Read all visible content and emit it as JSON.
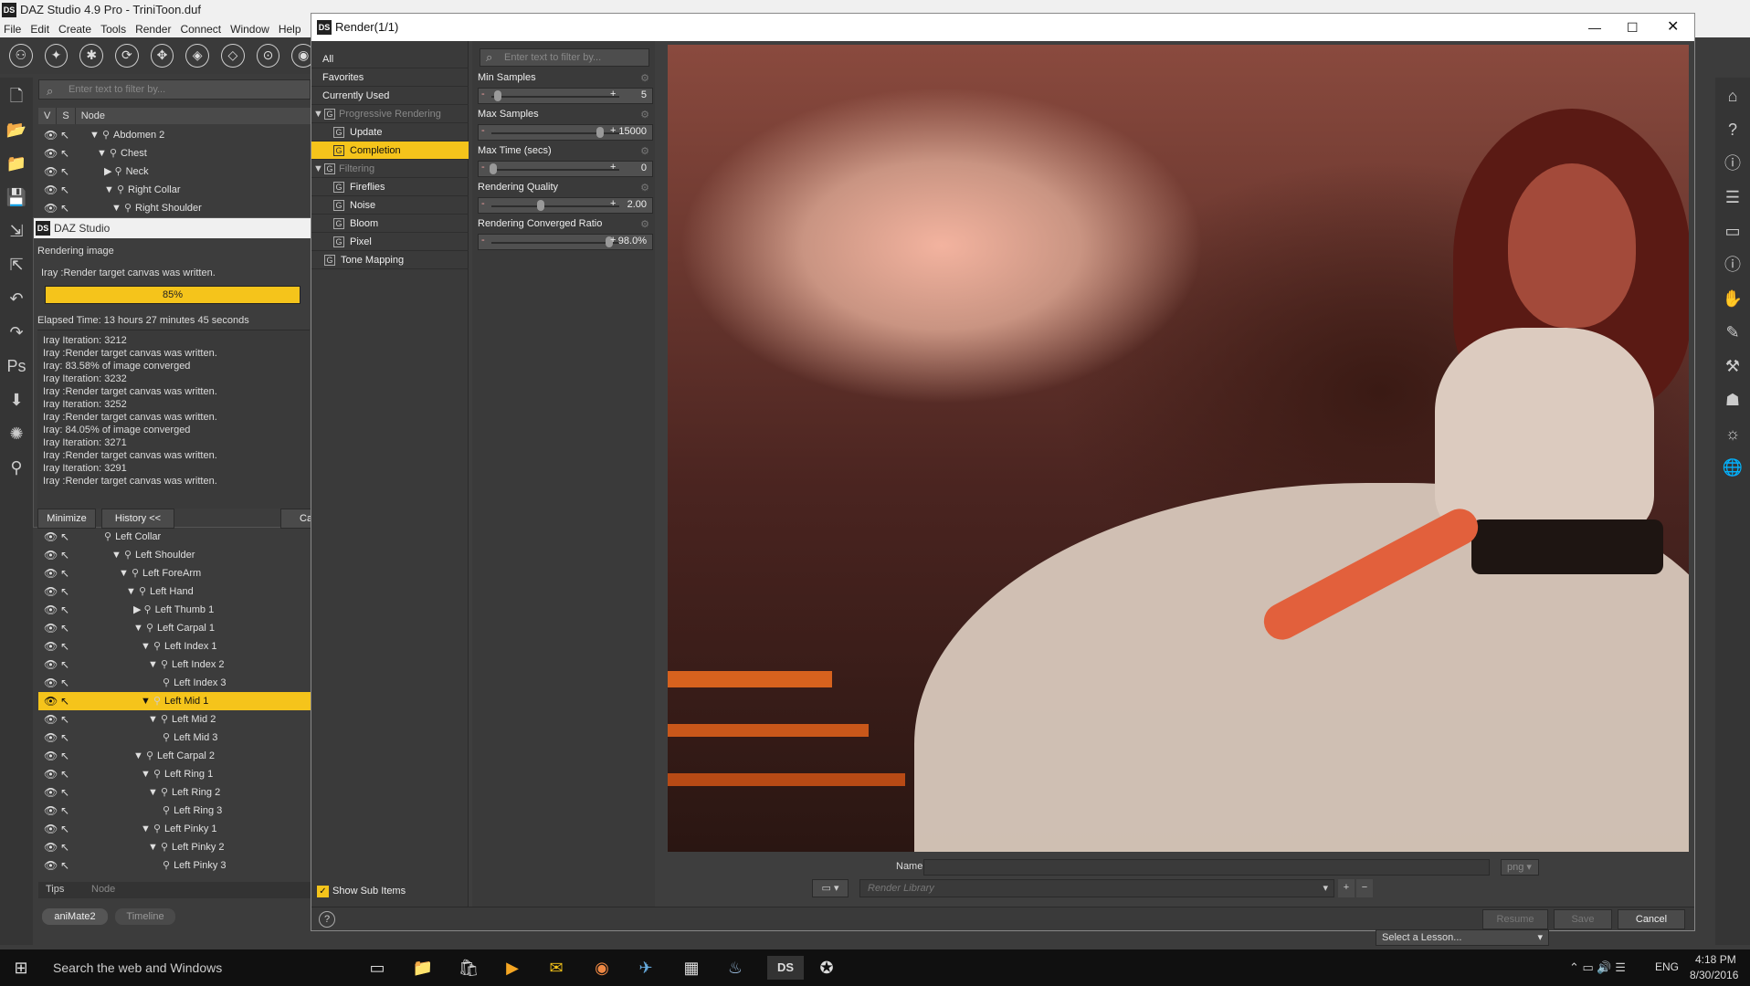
{
  "app": {
    "title": "DAZ Studio 4.9 Pro - TriniToon.duf",
    "logo": "DS"
  },
  "menu": [
    "File",
    "Edit",
    "Create",
    "Tools",
    "Render",
    "Connect",
    "Window",
    "Help"
  ],
  "scene": {
    "search_placeholder": "Enter text to filter by...",
    "columns": [
      "V",
      "S",
      "Node"
    ],
    "rows_top": [
      {
        "label": "Abdomen 2",
        "exp": "▼"
      },
      {
        "label": "Chest",
        "exp": "▼"
      },
      {
        "label": "Neck",
        "exp": "▶"
      },
      {
        "label": "Right Collar",
        "exp": "▼"
      },
      {
        "label": "Right Shoulder",
        "exp": "▼"
      }
    ],
    "rows_bottom": [
      {
        "label": "Left Collar",
        "exp": ""
      },
      {
        "label": "Left Shoulder",
        "exp": "▼"
      },
      {
        "label": "Left ForeArm",
        "exp": "▼"
      },
      {
        "label": "Left Hand",
        "exp": "▼"
      },
      {
        "label": "Left Thumb 1",
        "exp": "▶"
      },
      {
        "label": "Left Carpal 1",
        "exp": "▼"
      },
      {
        "label": "Left Index 1",
        "exp": "▼"
      },
      {
        "label": "Left Index 2",
        "exp": "▼"
      },
      {
        "label": "Left Index 3",
        "exp": ""
      },
      {
        "label": "Left Mid 1",
        "exp": "▼"
      },
      {
        "label": "Left Mid 2",
        "exp": "▼"
      },
      {
        "label": "Left Mid 3",
        "exp": ""
      },
      {
        "label": "Left Carpal 2",
        "exp": "▼"
      },
      {
        "label": "Left Ring 1",
        "exp": "▼"
      },
      {
        "label": "Left Ring 2",
        "exp": "▼"
      },
      {
        "label": "Left Ring 3",
        "exp": ""
      },
      {
        "label": "Left Pinky 1",
        "exp": "▼"
      },
      {
        "label": "Left Pinky 2",
        "exp": "▼"
      },
      {
        "label": "Left Pinky 3",
        "exp": ""
      }
    ],
    "tabs": [
      "Tips",
      "Node"
    ],
    "panel_tabs": [
      "aniMate2",
      "Timeline"
    ]
  },
  "progress": {
    "title": "DAZ Studio",
    "heading": "Rendering image",
    "status": "Iray :Render target canvas was written.",
    "percent": "85%",
    "percent_value": 85,
    "elapsed": "Elapsed Time:  13 hours 27 minutes 45 seconds",
    "log": [
      "Iray Iteration: 3212",
      "Iray :Render target canvas was written.",
      "Iray: 83.58% of image converged",
      "Iray Iteration: 3232",
      "Iray :Render target canvas was written.",
      "Iray Iteration: 3252",
      "Iray :Render target canvas was written.",
      "Iray: 84.05% of image converged",
      "Iray Iteration: 3271",
      "Iray :Render target canvas was written.",
      "Iray Iteration: 3291",
      "Iray :Render target canvas was written."
    ],
    "minimize": "Minimize",
    "history": "History <<",
    "cancel": "Ca"
  },
  "render": {
    "title": "Render(1/1)",
    "cats": [
      "All",
      "Favorites",
      "Currently Used"
    ],
    "group1": "Progressive Rendering",
    "group1_items": [
      "Update",
      "Completion"
    ],
    "group2": "Filtering",
    "group2_items": [
      "Fireflies",
      "Noise",
      "Bloom",
      "Pixel"
    ],
    "tone": "Tone Mapping",
    "show_sub": "Show Sub Items",
    "search_placeholder": "Enter text to filter by...",
    "props": [
      {
        "label": "Min Samples",
        "value": "5",
        "level": 0.04
      },
      {
        "label": "Max Samples",
        "value": "15000",
        "level": 0.9
      },
      {
        "label": "Max Time (secs)",
        "value": "0",
        "level": 0.0
      },
      {
        "label": "Rendering Quality",
        "value": "2.00",
        "level": 0.4
      },
      {
        "label": "Rendering Converged Ratio",
        "value": "98.0%",
        "level": 0.98
      }
    ],
    "name_label": "Name :",
    "format": "png",
    "library_placeholder": "Render Library",
    "resume": "Resume",
    "save": "Save",
    "cancel": "Cancel"
  },
  "lesson": "Select a Lesson...",
  "taskbar": {
    "search": "Search the web and Windows",
    "lang": "ENG",
    "time": "4:18 PM",
    "date": "8/30/2016"
  }
}
